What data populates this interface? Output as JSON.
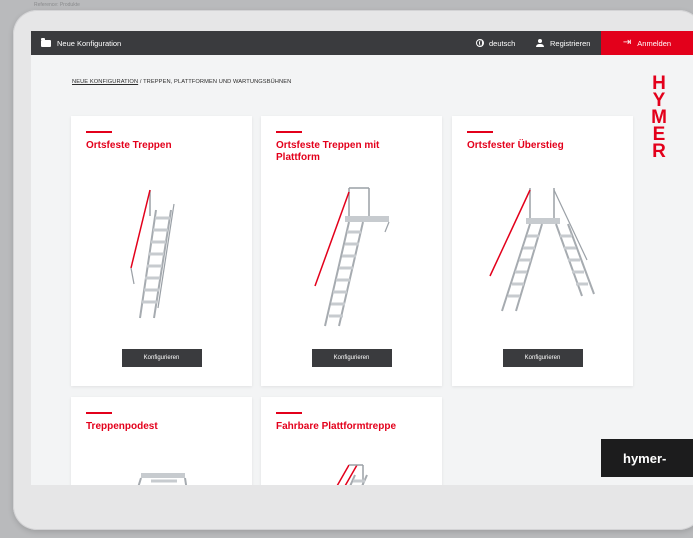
{
  "caption": "Reference: Produkte",
  "topbar": {
    "new_config": "Neue Konfiguration",
    "language": "deutsch",
    "register": "Registrieren",
    "login": "Anmelden",
    "accent": "#e3001b",
    "bar_color": "#3a3b3e"
  },
  "breadcrumb": {
    "link": "NEUE KONFIGURATION",
    "separator": "/",
    "current": "TREPPEN, PLATTFORMEN UND WARTUNGSBÜHNEN"
  },
  "logo": [
    "H",
    "Y",
    "M",
    "E",
    "R"
  ],
  "cards": [
    {
      "title": "Ortsfeste Treppen",
      "button": "Konfigurieren",
      "image_icon": "fixed-stairs-icon"
    },
    {
      "title": "Ortsfeste Treppen mit Plattform",
      "button": "Konfigurieren",
      "image_icon": "stairs-with-platform-icon"
    },
    {
      "title": "Ortsfester Überstieg",
      "button": "Konfigurieren",
      "image_icon": "crossover-icon"
    },
    {
      "title": "Treppenpodest",
      "image_icon": "stair-landing-icon"
    },
    {
      "title": "Fahrbare Plattformtreppe",
      "image_icon": "mobile-platform-stairs-icon"
    }
  ],
  "sticker": "hymer-"
}
